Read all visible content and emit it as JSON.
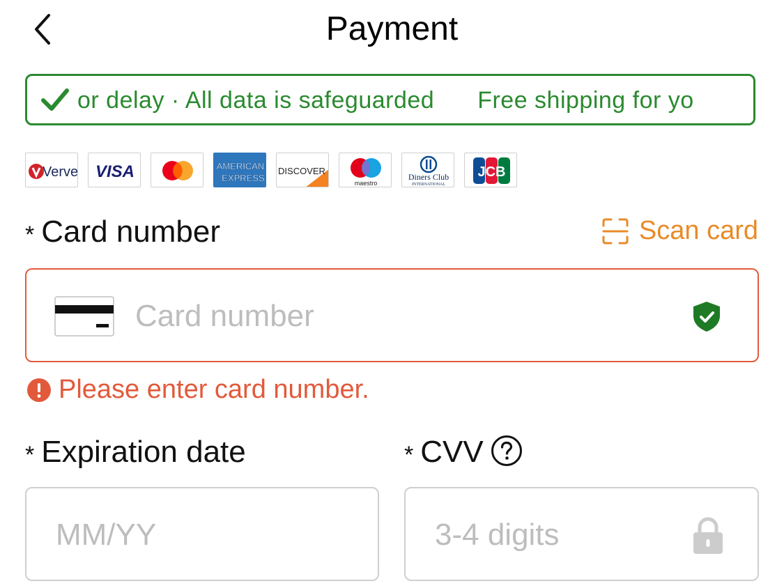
{
  "header": {
    "title": "Payment"
  },
  "banner": {
    "segment_1": "or delay · All data is safeguarded",
    "segment_2": "Free shipping for yo"
  },
  "card_brands": [
    "Verve",
    "VISA",
    "Mastercard",
    "American Express",
    "Discover",
    "Maestro",
    "Diners Club International",
    "JCB"
  ],
  "brand_texts": {
    "verve": "Verve",
    "visa": "VISA",
    "amex_1": "AMERICAN",
    "amex_2": "EXPRESS",
    "discover": "DISCOVER",
    "maestro": "maestro",
    "diners_1": "Diners Club",
    "diners_2": "INTERNATIONAL",
    "jcb": "JCB"
  },
  "card_number": {
    "required_mark": "*",
    "label": "Card number",
    "scan_label": "Scan card",
    "placeholder": "Card number",
    "error": "Please enter card number."
  },
  "expiration": {
    "required_mark": "*",
    "label": "Expiration date",
    "placeholder": "MM/YY"
  },
  "cvv": {
    "required_mark": "*",
    "label": "CVV",
    "placeholder": "3-4 digits"
  },
  "colors": {
    "banner_green": "#2a8a2f",
    "scan_orange": "#e88b28",
    "error_red": "#e25a3b",
    "placeholder_gray": "#bdbdbd"
  },
  "icons": {
    "back": "chevron-left-icon",
    "banner_check": "check-icon",
    "scan": "scan-icon",
    "card": "credit-card-icon",
    "secure": "shield-check-icon",
    "error": "exclamation-circle-icon",
    "help": "question-circle-icon",
    "lock": "lock-icon"
  }
}
